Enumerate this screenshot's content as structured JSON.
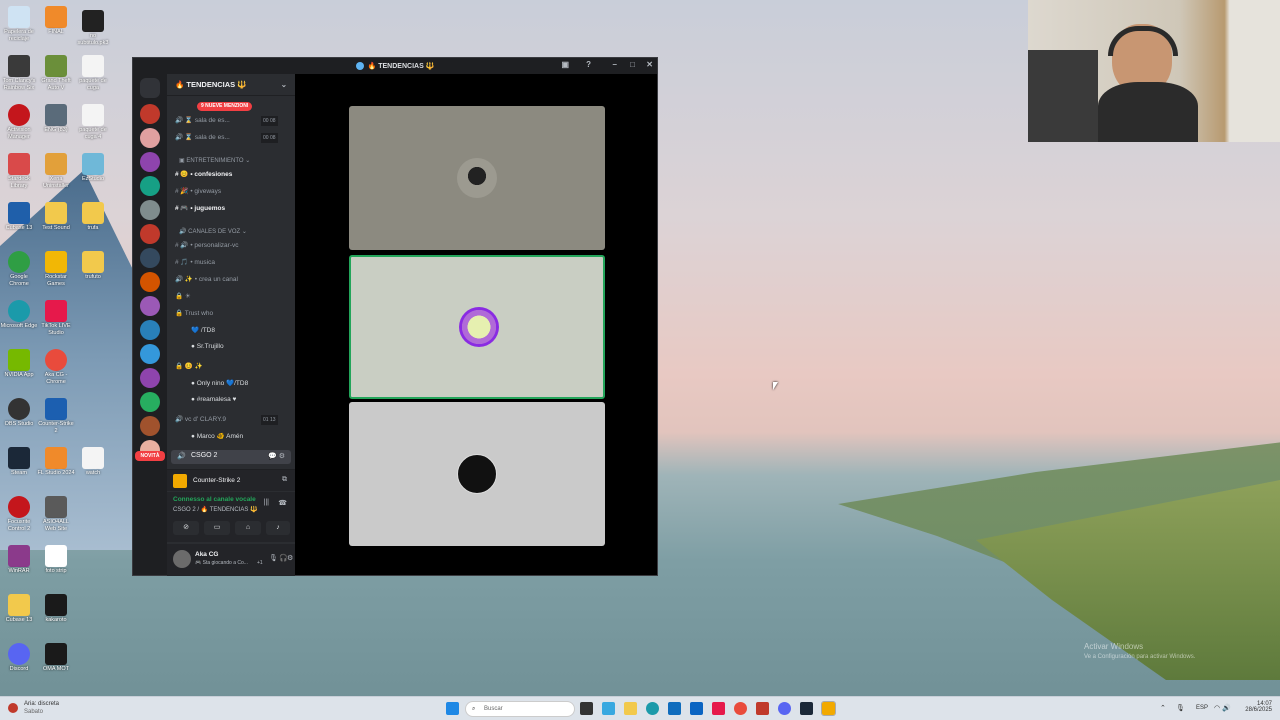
{
  "desktop": {
    "icons": [
      {
        "label": "Papelera de reciclaje"
      },
      {
        "label": "FINAL"
      },
      {
        "label": "no subtitulo.pk3"
      },
      {
        "label": "Tom Clancy's Rainbow Six"
      },
      {
        "label": "Grand Theft Auto V"
      },
      {
        "label": "paquete de cuga"
      },
      {
        "label": "Activision Manager"
      },
      {
        "label": "ENG (83)"
      },
      {
        "label": "paquete de cuga 4"
      },
      {
        "label": "Stardeck Library"
      },
      {
        "label": "Xena Uninstaller"
      },
      {
        "label": "EzStudio"
      },
      {
        "label": "Cubase 13"
      },
      {
        "label": "Test Sound"
      },
      {
        "label": "trufa"
      },
      {
        "label": "Google Chrome"
      },
      {
        "label": "Rockstar Games"
      },
      {
        "label": "trufuto"
      },
      {
        "label": "Microsoft Edge"
      },
      {
        "label": "TikTok LIVE Studio"
      },
      {
        "label": "NVIDIA App"
      },
      {
        "label": "Aka CG - Chrome"
      },
      {
        "label": "OBS Studio"
      },
      {
        "label": "Counter-Strike 2"
      },
      {
        "label": "Steam"
      },
      {
        "label": "FL Studio 2024"
      },
      {
        "label": "watch"
      },
      {
        "label": "Focusrite Control 2"
      },
      {
        "label": "ASIO4ALL Web Site"
      },
      {
        "label": "WinRAR"
      },
      {
        "label": "foto strip"
      },
      {
        "label": "Cubase 13"
      },
      {
        "label": "kakaroto"
      },
      {
        "label": "Discord"
      },
      {
        "label": "OMA MOT"
      }
    ]
  },
  "discord": {
    "window_title": "🔥 TENDENCIAS 🔱",
    "server_name": "🔥 TENDENCIAS 🔱",
    "mentions_badge": "9 NUEVE MENZIONI",
    "channels": [
      {
        "name": "sala de es...",
        "counter": "00 08"
      },
      {
        "name": "sala de es...",
        "counter": "00 08"
      }
    ],
    "category_entertainment": "ENTRETENIMIENTO",
    "text_channels": [
      "confesiones",
      "giveways",
      "juguemos"
    ],
    "category_voice": "CANALES DE VOZ",
    "voice_channels": [
      "personalizar-vc",
      "musica",
      "crea un canal"
    ],
    "trust_channel": "Trust who",
    "trust_members": [
      "/TD8",
      "Sr.Trujillo"
    ],
    "stars_members": [
      "Only nino",
      "/TD8",
      "#reamalesa"
    ],
    "vc_channel": "vc d' CLARY.9",
    "vc_counter": "01 13",
    "vc_member": "Marco 🐠 Amén",
    "current_channel": "CSGO 2",
    "novita_label": "NOVITÀ",
    "activity": "Counter-Strike 2",
    "voice_status": "Connesso al canale vocale",
    "voice_location": "CSGO 2 / 🔥 TENDENCIAS 🔱",
    "user_name": "Aka CG",
    "user_status": "🎮 Sta giocando a Co...",
    "user_status_count": "+1"
  },
  "taskbar": {
    "weather_title": "Aria: discreta",
    "weather_sub": "Sabato",
    "search_placeholder": "Buscar",
    "lang": "ESP",
    "time": "14:07",
    "date": "28/6/2025"
  },
  "watermark": {
    "title": "Activar Windows",
    "subtitle": "Ve a Configuración para activar Windows."
  }
}
